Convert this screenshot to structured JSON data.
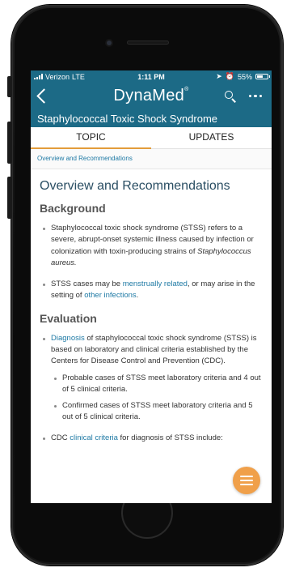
{
  "status_bar": {
    "carrier": "Verizon",
    "network": "LTE",
    "time": "1:11 PM",
    "battery_percent": "55%",
    "battery_level": 0.55,
    "icons": [
      "location-arrow-icon",
      "alarm-icon",
      "battery-icon"
    ]
  },
  "nav": {
    "brand": "DynaMed",
    "brand_mark": "®",
    "icons": [
      "back-chevron-icon",
      "search-icon",
      "more-icon"
    ]
  },
  "title": "Staphylococcal Toxic Shock Syndrome",
  "tabs": [
    {
      "label": "TOPIC",
      "active": true
    },
    {
      "label": "UPDATES",
      "active": false
    }
  ],
  "breadcrumb": "Overview and Recommendations",
  "content": {
    "heading": "Overview and Recommendations",
    "background": {
      "heading": "Background",
      "item1_text": "Staphylococcal toxic shock syndrome (STSS) refers to a severe, abrupt-onset systemic illness caused by infection or colonization with toxin-producing strains of ",
      "item1_italic": "Staphylococcus aureus.",
      "item2_text_a": "STSS cases may be ",
      "item2_link_a": "menstrually related",
      "item2_text_b": ", or may arise in the setting of ",
      "item2_link_b": "other infections",
      "item2_text_c": "."
    },
    "evaluation": {
      "heading": "Evaluation",
      "item1_link": "Diagnosis",
      "item1_text": " of staphylococcal toxic shock syndrome (STSS) is based on laboratory and clinical criteria established by the Centers for Disease Control and Prevention (CDC).",
      "sub1": "Probable cases of STSS meet laboratory criteria and 4 out of 5 clinical criteria.",
      "sub2": "Confirmed cases of STSS meet laboratory criteria and 5 out of 5 clinical criteria.",
      "item2_text_a": "CDC ",
      "item2_link": "clinical criteria",
      "item2_text_b": " for diagnosis of STSS include:"
    }
  },
  "fab_icon": "list-icon",
  "colors": {
    "header": "#1c6a86",
    "accent": "#e39c3a",
    "link": "#1f7aa5",
    "fab": "#f0a04a"
  }
}
